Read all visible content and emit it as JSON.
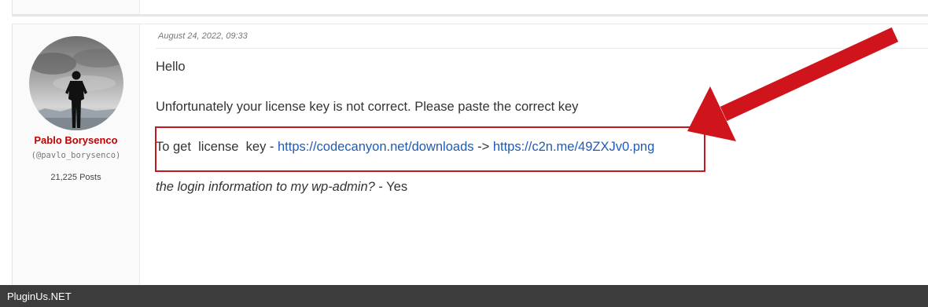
{
  "post": {
    "author": {
      "name": "Pablo Borysenco",
      "handle": "(@pavlo_borysenco)",
      "posts": "21,225 Posts"
    },
    "date": "August 24, 2022, 09:33",
    "greeting": "Hello",
    "message": "Unfortunately your license key is not correct. Please paste the correct key",
    "key_line": {
      "prefix": "To get  license  key - ",
      "link1": "https://codecanyon.net/downloads",
      "separator": " -> ",
      "link2": "https://c2n.me/49ZXJv0.png"
    },
    "question": {
      "italic": "the login information to my wp-admin?",
      "answer": " - Yes"
    }
  },
  "annotation": {
    "color": "#d0141c"
  },
  "footer": {
    "brand": "PluginUs.NET"
  },
  "colors": {
    "author_name": "#c40000",
    "link": "#1f5bb5",
    "footer_bg": "#3c3c3c"
  }
}
